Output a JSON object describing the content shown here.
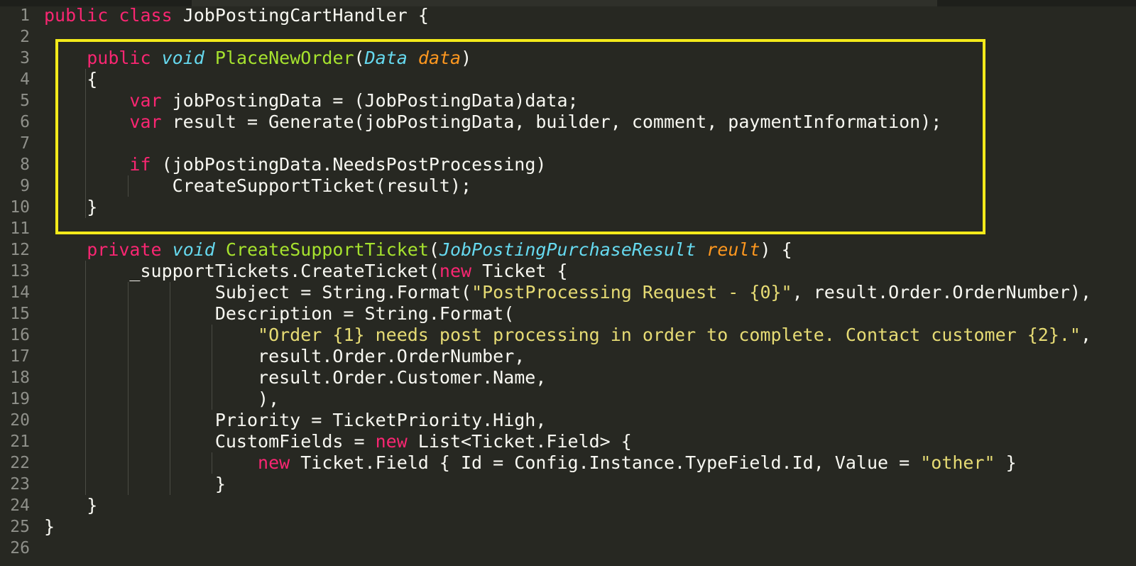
{
  "editor": {
    "theme_colors": {
      "background": "#272822",
      "keyword": "#f92672",
      "type": "#66d9ef",
      "function": "#a6e22e",
      "parameter": "#fd971f",
      "string": "#e6db74",
      "highlight_box": "#f3ea1a"
    },
    "lines": [
      {
        "n": "1",
        "tokens": [
          {
            "t": "kw",
            "v": "public"
          },
          {
            "t": "p",
            "v": " "
          },
          {
            "t": "kw",
            "v": "class"
          },
          {
            "t": "p",
            "v": " JobPostingCartHandler {"
          }
        ]
      },
      {
        "n": "2",
        "tokens": []
      },
      {
        "n": "3",
        "tokens": [
          {
            "t": "p",
            "v": "    "
          },
          {
            "t": "kw",
            "v": "public"
          },
          {
            "t": "p",
            "v": " "
          },
          {
            "t": "ty",
            "v": "void"
          },
          {
            "t": "p",
            "v": " "
          },
          {
            "t": "fn",
            "v": "PlaceNewOrder"
          },
          {
            "t": "p",
            "v": "("
          },
          {
            "t": "ty",
            "v": "Data"
          },
          {
            "t": "p",
            "v": " "
          },
          {
            "t": "pa",
            "v": "data"
          },
          {
            "t": "p",
            "v": ")"
          }
        ]
      },
      {
        "n": "4",
        "tokens": [
          {
            "t": "p",
            "v": "    {"
          }
        ]
      },
      {
        "n": "5",
        "tokens": [
          {
            "t": "p",
            "v": "        "
          },
          {
            "t": "kw",
            "v": "var"
          },
          {
            "t": "p",
            "v": " jobPostingData = (JobPostingData)data;"
          }
        ]
      },
      {
        "n": "6",
        "tokens": [
          {
            "t": "p",
            "v": "        "
          },
          {
            "t": "kw",
            "v": "var"
          },
          {
            "t": "p",
            "v": " result = Generate(jobPostingData, builder, comment, paymentInformation);"
          }
        ]
      },
      {
        "n": "7",
        "tokens": []
      },
      {
        "n": "8",
        "tokens": [
          {
            "t": "p",
            "v": "        "
          },
          {
            "t": "kw",
            "v": "if"
          },
          {
            "t": "p",
            "v": " (jobPostingData.NeedsPostProcessing)"
          }
        ]
      },
      {
        "n": "9",
        "tokens": [
          {
            "t": "p",
            "v": "            CreateSupportTicket(result);"
          }
        ]
      },
      {
        "n": "10",
        "tokens": [
          {
            "t": "p",
            "v": "    }"
          }
        ]
      },
      {
        "n": "11",
        "tokens": []
      },
      {
        "n": "12",
        "tokens": [
          {
            "t": "p",
            "v": "    "
          },
          {
            "t": "kw",
            "v": "private"
          },
          {
            "t": "p",
            "v": " "
          },
          {
            "t": "ty",
            "v": "void"
          },
          {
            "t": "p",
            "v": " "
          },
          {
            "t": "fn",
            "v": "CreateSupportTicket"
          },
          {
            "t": "p",
            "v": "("
          },
          {
            "t": "ty",
            "v": "JobPostingPurchaseResult"
          },
          {
            "t": "p",
            "v": " "
          },
          {
            "t": "pa",
            "v": "reult"
          },
          {
            "t": "p",
            "v": ") {"
          }
        ]
      },
      {
        "n": "13",
        "tokens": [
          {
            "t": "p",
            "v": "        _supportTickets.CreateTicket("
          },
          {
            "t": "kw",
            "v": "new"
          },
          {
            "t": "p",
            "v": " Ticket {"
          }
        ]
      },
      {
        "n": "14",
        "tokens": [
          {
            "t": "p",
            "v": "                Subject = String.Format("
          },
          {
            "t": "st",
            "v": "\"PostProcessing Request - {0}\""
          },
          {
            "t": "p",
            "v": ", result.Order.OrderNumber),"
          }
        ]
      },
      {
        "n": "15",
        "tokens": [
          {
            "t": "p",
            "v": "                Description = String.Format("
          }
        ]
      },
      {
        "n": "16",
        "tokens": [
          {
            "t": "p",
            "v": "                    "
          },
          {
            "t": "st",
            "v": "\"Order {1} needs post processing in order to complete. Contact customer {2}.\""
          },
          {
            "t": "p",
            "v": ","
          }
        ]
      },
      {
        "n": "17",
        "tokens": [
          {
            "t": "p",
            "v": "                    result.Order.OrderNumber,"
          }
        ]
      },
      {
        "n": "18",
        "tokens": [
          {
            "t": "p",
            "v": "                    result.Order.Customer.Name,"
          }
        ]
      },
      {
        "n": "19",
        "tokens": [
          {
            "t": "p",
            "v": "                    ),"
          }
        ]
      },
      {
        "n": "20",
        "tokens": [
          {
            "t": "p",
            "v": "                Priority = TicketPriority.High,"
          }
        ]
      },
      {
        "n": "21",
        "tokens": [
          {
            "t": "p",
            "v": "                CustomFields = "
          },
          {
            "t": "kw",
            "v": "new"
          },
          {
            "t": "p",
            "v": " List<Ticket.Field> {"
          }
        ]
      },
      {
        "n": "22",
        "tokens": [
          {
            "t": "p",
            "v": "                    "
          },
          {
            "t": "kw",
            "v": "new"
          },
          {
            "t": "p",
            "v": " Ticket.Field { Id = Config.Instance.TypeField.Id, Value = "
          },
          {
            "t": "st",
            "v": "\"other\""
          },
          {
            "t": "p",
            "v": " }"
          }
        ]
      },
      {
        "n": "23",
        "tokens": [
          {
            "t": "p",
            "v": "                }"
          }
        ]
      },
      {
        "n": "24",
        "tokens": [
          {
            "t": "p",
            "v": "    }"
          }
        ]
      },
      {
        "n": "25",
        "tokens": [
          {
            "t": "p",
            "v": "}"
          }
        ]
      },
      {
        "n": "26",
        "tokens": []
      }
    ]
  }
}
